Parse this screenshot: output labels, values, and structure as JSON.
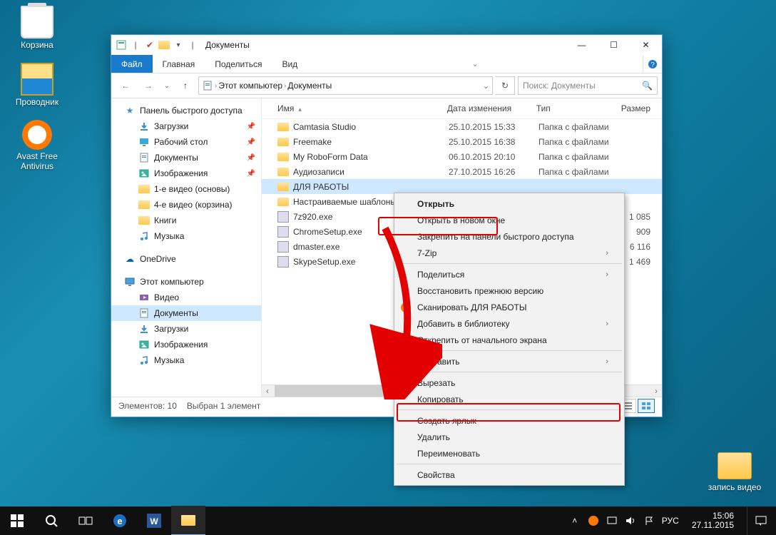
{
  "desktop": {
    "icons": [
      {
        "name": "recycle-bin",
        "label": "Корзина"
      },
      {
        "name": "explorer",
        "label": "Проводник"
      },
      {
        "name": "avast",
        "label": "Avast Free Antivirus"
      }
    ],
    "folder": {
      "label": "запись видео"
    }
  },
  "window": {
    "title": "Документы",
    "tabs": {
      "file": "Файл",
      "home": "Главная",
      "share": "Поделиться",
      "view": "Вид"
    },
    "breadcrumb": [
      "Этот компьютер",
      "Документы"
    ],
    "search_placeholder": "Поиск: Документы",
    "columns": {
      "name": "Имя",
      "date": "Дата изменения",
      "type": "Тип",
      "size": "Размер"
    },
    "nav": {
      "quick": "Панель быстрого доступа",
      "quick_items": [
        {
          "label": "Загрузки",
          "pin": true,
          "icon": "download"
        },
        {
          "label": "Рабочий стол",
          "pin": true,
          "icon": "desktop"
        },
        {
          "label": "Документы",
          "pin": true,
          "icon": "document"
        },
        {
          "label": "Изображения",
          "pin": true,
          "icon": "picture"
        },
        {
          "label": "1-е видео (основы)",
          "pin": false,
          "icon": "folder"
        },
        {
          "label": "4-е видео (корзина)",
          "pin": false,
          "icon": "folder"
        },
        {
          "label": "Книги",
          "pin": false,
          "icon": "folder"
        },
        {
          "label": "Музыка",
          "pin": false,
          "icon": "music"
        }
      ],
      "onedrive": "OneDrive",
      "thispc": "Этот компьютер",
      "thispc_items": [
        {
          "label": "Видео",
          "icon": "video"
        },
        {
          "label": "Документы",
          "icon": "document",
          "selected": true
        },
        {
          "label": "Загрузки",
          "icon": "download"
        },
        {
          "label": "Изображения",
          "icon": "picture"
        },
        {
          "label": "Музыка",
          "icon": "music"
        }
      ]
    },
    "files": [
      {
        "name": "Camtasia Studio",
        "date": "25.10.2015 15:33",
        "type": "Папка с файлами",
        "size": "",
        "icon": "folder"
      },
      {
        "name": "Freemake",
        "date": "25.10.2015 16:38",
        "type": "Папка с файлами",
        "size": "",
        "icon": "folder"
      },
      {
        "name": "My RoboForm Data",
        "date": "06.10.2015 20:10",
        "type": "Папка с файлами",
        "size": "",
        "icon": "folder"
      },
      {
        "name": "Аудиозаписи",
        "date": "27.10.2015 16:26",
        "type": "Папка с файлами",
        "size": "",
        "icon": "folder"
      },
      {
        "name": "ДЛЯ РАБОТЫ",
        "date": "",
        "type": "",
        "size": "",
        "icon": "folder",
        "selected": true
      },
      {
        "name": "Настраиваемые шаблоны",
        "date": "",
        "type": "",
        "size": "",
        "icon": "folder"
      },
      {
        "name": "7z920.exe",
        "date": "",
        "type": "",
        "size": "1 085",
        "icon": "exe"
      },
      {
        "name": "ChromeSetup.exe",
        "date": "",
        "type": "",
        "size": "909",
        "icon": "exe"
      },
      {
        "name": "dmaster.exe",
        "date": "",
        "type": "",
        "size": "6 116",
        "icon": "exe"
      },
      {
        "name": "SkypeSetup.exe",
        "date": "",
        "type": "",
        "size": "1 469",
        "icon": "exe"
      }
    ],
    "status": {
      "count": "Элементов: 10",
      "selected": "Выбран 1 элемент"
    }
  },
  "context_menu": {
    "items": [
      {
        "label": "Открыть",
        "bold": true
      },
      {
        "label": "Открыть в новом окне"
      },
      {
        "label": "Закрепить на панели быстрого доступа"
      },
      {
        "label": "7-Zip",
        "sub": true
      },
      {
        "sep": true
      },
      {
        "label": "Поделиться",
        "sub": true
      },
      {
        "label": "Восстановить прежнюю версию"
      },
      {
        "label": "Сканировать ДЛЯ РАБОТЫ",
        "icon": "avast"
      },
      {
        "label": "Добавить в библиотеку",
        "sub": true
      },
      {
        "label": "Открепить от начального экрана"
      },
      {
        "sep": true
      },
      {
        "label": "Отправить",
        "sub": true
      },
      {
        "sep": true
      },
      {
        "label": "Вырезать"
      },
      {
        "label": "Копировать"
      },
      {
        "sep": true
      },
      {
        "label": "Создать ярлык",
        "highlight": true
      },
      {
        "label": "Удалить"
      },
      {
        "label": "Переименовать"
      },
      {
        "sep": true
      },
      {
        "label": "Свойства"
      }
    ]
  },
  "taskbar": {
    "lang": "РУС",
    "time": "15:06",
    "date": "27.11.2015"
  }
}
